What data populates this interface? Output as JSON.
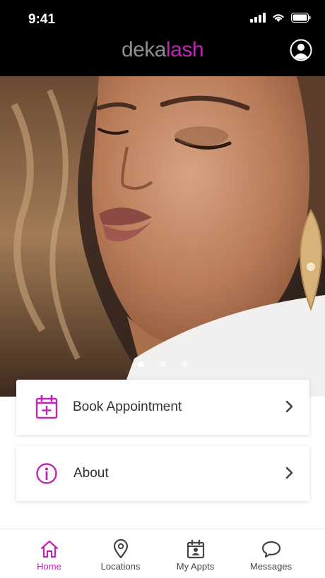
{
  "status_bar": {
    "time": "9:41"
  },
  "header": {
    "logo_part1": "deka",
    "logo_part2": "lash"
  },
  "carousel": {
    "total": 3,
    "active": 1
  },
  "menu": [
    {
      "label": "Book Appointment",
      "icon": "calendar-plus-icon"
    },
    {
      "label": "About",
      "icon": "info-icon"
    }
  ],
  "tabs": [
    {
      "label": "Home",
      "icon": "home-icon",
      "active": true
    },
    {
      "label": "Locations",
      "icon": "map-pin-icon",
      "active": false
    },
    {
      "label": "My Appts",
      "icon": "calendar-user-icon",
      "active": false
    },
    {
      "label": "Messages",
      "icon": "chat-bubble-icon",
      "active": false
    }
  ],
  "colors": {
    "accent": "#c026b4",
    "header_bg": "#000000",
    "logo_gray": "#8e8e8e"
  }
}
